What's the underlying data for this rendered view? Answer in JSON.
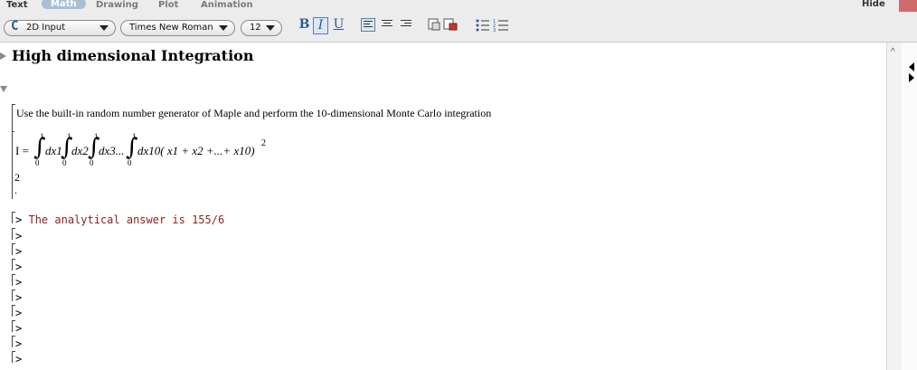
{
  "tabs": [
    {
      "label": "Text"
    },
    {
      "label": "Math"
    },
    {
      "label": "Drawing"
    },
    {
      "label": "Plot"
    },
    {
      "label": "Animation"
    }
  ],
  "hide_label": "Hide",
  "toolbar": {
    "input_mode": "2D Input",
    "font": "Times New Roman",
    "size": "12",
    "bold": "B",
    "italic": "I",
    "underline": "U"
  },
  "document": {
    "section_title": "High dimensional Integration",
    "paragraph": "Use the built-in random number generator of Maple and perform the 10-dimensional Monte Carlo integration",
    "math": {
      "lhs": "I =",
      "upper": "1",
      "lower": "0",
      "d1": "dx1",
      "d2": "dx2",
      "d3": "dx3...",
      "d10": "dx10( x1 + x2 +...+ x10)",
      "exp": "2"
    },
    "line_2": "2",
    "line_dot": ".",
    "prompt_symbol": ">",
    "command": "The analytical answer is 155/6"
  },
  "colors": {
    "accent": "#2a5a9a",
    "command_text": "#8a1f1f",
    "active_tab": "#a9bfd6"
  }
}
